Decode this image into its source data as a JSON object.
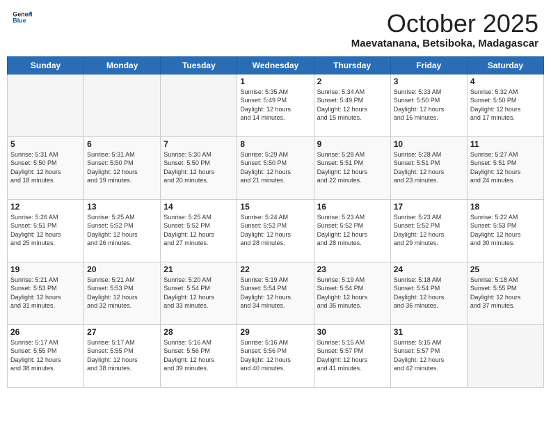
{
  "logo": {
    "general": "General",
    "blue": "Blue"
  },
  "header": {
    "month": "October 2025",
    "location": "Maevatanana, Betsiboka, Madagascar"
  },
  "weekdays": [
    "Sunday",
    "Monday",
    "Tuesday",
    "Wednesday",
    "Thursday",
    "Friday",
    "Saturday"
  ],
  "weeks": [
    [
      {
        "day": "",
        "info": ""
      },
      {
        "day": "",
        "info": ""
      },
      {
        "day": "",
        "info": ""
      },
      {
        "day": "1",
        "info": "Sunrise: 5:35 AM\nSunset: 5:49 PM\nDaylight: 12 hours\nand 14 minutes."
      },
      {
        "day": "2",
        "info": "Sunrise: 5:34 AM\nSunset: 5:49 PM\nDaylight: 12 hours\nand 15 minutes."
      },
      {
        "day": "3",
        "info": "Sunrise: 5:33 AM\nSunset: 5:50 PM\nDaylight: 12 hours\nand 16 minutes."
      },
      {
        "day": "4",
        "info": "Sunrise: 5:32 AM\nSunset: 5:50 PM\nDaylight: 12 hours\nand 17 minutes."
      }
    ],
    [
      {
        "day": "5",
        "info": "Sunrise: 5:31 AM\nSunset: 5:50 PM\nDaylight: 12 hours\nand 18 minutes."
      },
      {
        "day": "6",
        "info": "Sunrise: 5:31 AM\nSunset: 5:50 PM\nDaylight: 12 hours\nand 19 minutes."
      },
      {
        "day": "7",
        "info": "Sunrise: 5:30 AM\nSunset: 5:50 PM\nDaylight: 12 hours\nand 20 minutes."
      },
      {
        "day": "8",
        "info": "Sunrise: 5:29 AM\nSunset: 5:50 PM\nDaylight: 12 hours\nand 21 minutes."
      },
      {
        "day": "9",
        "info": "Sunrise: 5:28 AM\nSunset: 5:51 PM\nDaylight: 12 hours\nand 22 minutes."
      },
      {
        "day": "10",
        "info": "Sunrise: 5:28 AM\nSunset: 5:51 PM\nDaylight: 12 hours\nand 23 minutes."
      },
      {
        "day": "11",
        "info": "Sunrise: 5:27 AM\nSunset: 5:51 PM\nDaylight: 12 hours\nand 24 minutes."
      }
    ],
    [
      {
        "day": "12",
        "info": "Sunrise: 5:26 AM\nSunset: 5:51 PM\nDaylight: 12 hours\nand 25 minutes."
      },
      {
        "day": "13",
        "info": "Sunrise: 5:25 AM\nSunset: 5:52 PM\nDaylight: 12 hours\nand 26 minutes."
      },
      {
        "day": "14",
        "info": "Sunrise: 5:25 AM\nSunset: 5:52 PM\nDaylight: 12 hours\nand 27 minutes."
      },
      {
        "day": "15",
        "info": "Sunrise: 5:24 AM\nSunset: 5:52 PM\nDaylight: 12 hours\nand 28 minutes."
      },
      {
        "day": "16",
        "info": "Sunrise: 5:23 AM\nSunset: 5:52 PM\nDaylight: 12 hours\nand 28 minutes."
      },
      {
        "day": "17",
        "info": "Sunrise: 5:23 AM\nSunset: 5:52 PM\nDaylight: 12 hours\nand 29 minutes."
      },
      {
        "day": "18",
        "info": "Sunrise: 5:22 AM\nSunset: 5:53 PM\nDaylight: 12 hours\nand 30 minutes."
      }
    ],
    [
      {
        "day": "19",
        "info": "Sunrise: 5:21 AM\nSunset: 5:53 PM\nDaylight: 12 hours\nand 31 minutes."
      },
      {
        "day": "20",
        "info": "Sunrise: 5:21 AM\nSunset: 5:53 PM\nDaylight: 12 hours\nand 32 minutes."
      },
      {
        "day": "21",
        "info": "Sunrise: 5:20 AM\nSunset: 5:54 PM\nDaylight: 12 hours\nand 33 minutes."
      },
      {
        "day": "22",
        "info": "Sunrise: 5:19 AM\nSunset: 5:54 PM\nDaylight: 12 hours\nand 34 minutes."
      },
      {
        "day": "23",
        "info": "Sunrise: 5:19 AM\nSunset: 5:54 PM\nDaylight: 12 hours\nand 35 minutes."
      },
      {
        "day": "24",
        "info": "Sunrise: 5:18 AM\nSunset: 5:54 PM\nDaylight: 12 hours\nand 36 minutes."
      },
      {
        "day": "25",
        "info": "Sunrise: 5:18 AM\nSunset: 5:55 PM\nDaylight: 12 hours\nand 37 minutes."
      }
    ],
    [
      {
        "day": "26",
        "info": "Sunrise: 5:17 AM\nSunset: 5:55 PM\nDaylight: 12 hours\nand 38 minutes."
      },
      {
        "day": "27",
        "info": "Sunrise: 5:17 AM\nSunset: 5:55 PM\nDaylight: 12 hours\nand 38 minutes."
      },
      {
        "day": "28",
        "info": "Sunrise: 5:16 AM\nSunset: 5:56 PM\nDaylight: 12 hours\nand 39 minutes."
      },
      {
        "day": "29",
        "info": "Sunrise: 5:16 AM\nSunset: 5:56 PM\nDaylight: 12 hours\nand 40 minutes."
      },
      {
        "day": "30",
        "info": "Sunrise: 5:15 AM\nSunset: 5:57 PM\nDaylight: 12 hours\nand 41 minutes."
      },
      {
        "day": "31",
        "info": "Sunrise: 5:15 AM\nSunset: 5:57 PM\nDaylight: 12 hours\nand 42 minutes."
      },
      {
        "day": "",
        "info": ""
      }
    ]
  ]
}
